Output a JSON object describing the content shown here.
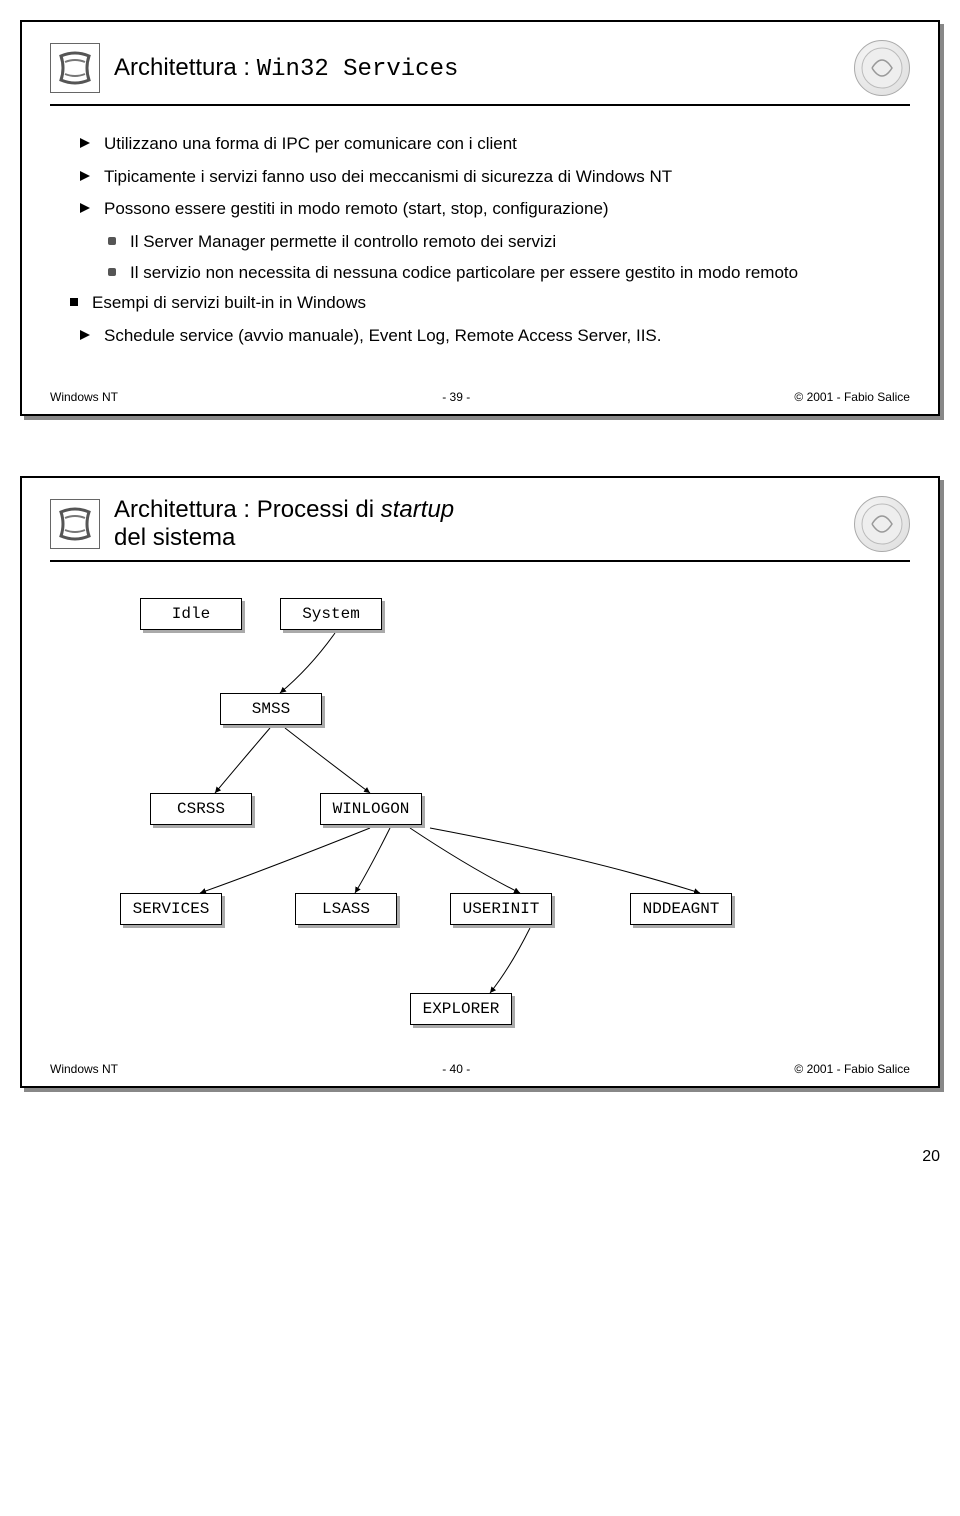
{
  "slide1": {
    "title_prefix": "Architettura : ",
    "title_mono": "Win32 Services",
    "bullets": {
      "b1": "Utilizzano una forma di IPC per comunicare con i client",
      "b2": "Tipicamente i servizi fanno uso dei meccanismi di sicurezza di Windows NT",
      "b3": "Possono essere gestiti in modo remoto  (start, stop, configurazione)",
      "b3a": "Il Server Manager permette il controllo remoto dei servizi",
      "b3b": "Il servizio non necessita di nessuna codice particolare per essere gestito in modo remoto",
      "b4": "Esempi di servizi built-in in Windows",
      "b4a": "Schedule service (avvio manuale), Event Log, Remote Access Server, IIS."
    },
    "footer_left": "Windows NT",
    "footer_center": "- 39 -",
    "footer_right": "© 2001 - Fabio Salice"
  },
  "slide2": {
    "title_line1": "Architettura :  Processi di ",
    "title_italic": "startup",
    "title_line2": "del sistema",
    "boxes": {
      "idle": "Idle",
      "system": "System",
      "smss": "SMSS",
      "csrss": "CSRSS",
      "winlogon": "WINLOGON",
      "services": "SERVICES",
      "lsass": "LSASS",
      "userinit": "USERINIT",
      "nddeagnt": "NDDEAGNT",
      "explorer": "EXPLORER"
    },
    "footer_left": "Windows NT",
    "footer_center": "- 40 -",
    "footer_right": "© 2001 - Fabio Salice"
  },
  "page_number": "20"
}
